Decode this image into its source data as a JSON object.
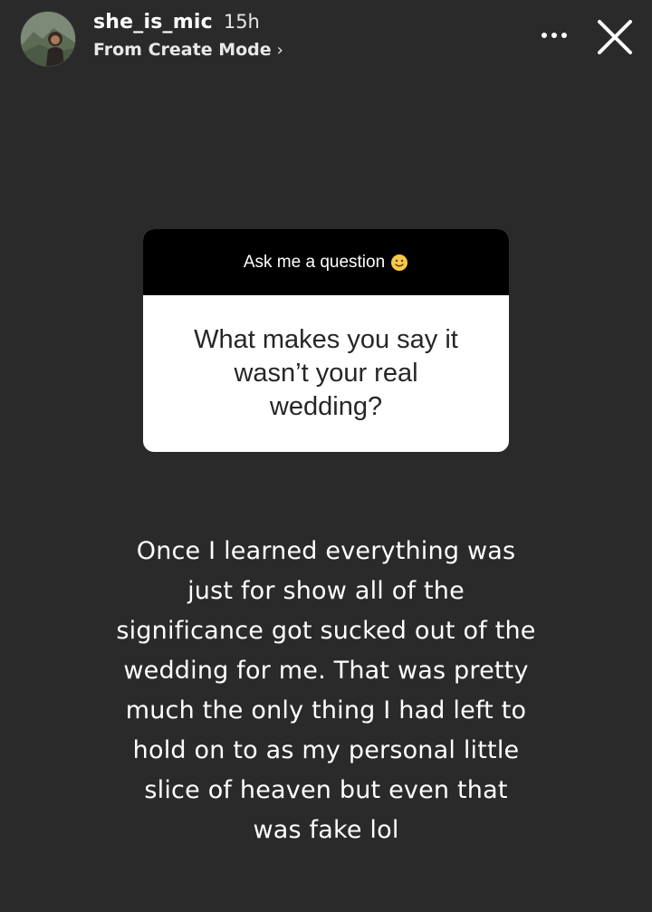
{
  "header": {
    "username": "she_is_mic",
    "time": "15h",
    "subtitle": "From Create Mode",
    "chevron": "›",
    "avatar_icon": "profile-photo",
    "more_icon": "more-dots-icon",
    "close_icon": "close-icon"
  },
  "sticker": {
    "title": "Ask me a question",
    "emoji": "smiling-face-emoji",
    "question": "What makes you say it\nwasn’t your real\nwedding?"
  },
  "answer": {
    "text": "Once I learned everything was\njust for show all of the\nsignificance got sucked out of the\nwedding for me. That was pretty\nmuch the only thing I had left to\nhold on to as my personal little\nslice of heaven but even that\nwas fake lol"
  },
  "colors": {
    "background": "#2a2a2a",
    "sticker_header": "#000000",
    "sticker_body": "#ffffff",
    "text": "#ffffff",
    "question_text": "#262626",
    "emoji_yellow": "#f7c948"
  }
}
